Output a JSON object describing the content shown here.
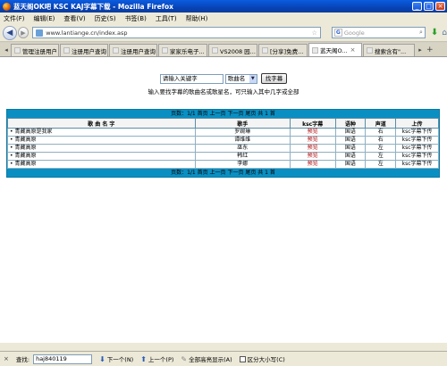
{
  "window": {
    "title": "蓝天阁OK吧 KSC KAJ字幕下载 - Mozilla Firefox"
  },
  "menu": [
    "文件(F)",
    "编辑(E)",
    "查看(V)",
    "历史(S)",
    "书签(B)",
    "工具(T)",
    "帮助(H)"
  ],
  "nav": {
    "url": "www.lantiange.cn/index.asp",
    "search_placeholder": "Google",
    "search_engine_letter": "G"
  },
  "tabs": [
    {
      "label": "管理注册用户",
      "active": false
    },
    {
      "label": "注册用户查询",
      "active": false
    },
    {
      "label": "注册用户查询",
      "active": false
    },
    {
      "label": "家家乐电子...",
      "active": false
    },
    {
      "label": "VS2008 园...",
      "active": false
    },
    {
      "label": "[分享]免费...",
      "active": false
    },
    {
      "label": "蓝天阁O...",
      "active": true
    },
    {
      "label": "搜索含有\"...",
      "active": false
    }
  ],
  "search": {
    "keyword_value": "请输入关键字",
    "select_value": "歌曲名",
    "button_label": "找字幕",
    "hint": "输入要找字幕的歌曲名或歌星名，可只输入其中几字或全部"
  },
  "pager": {
    "text": "页数：1/1  首页  上一页  下一页  尾页  共 1 首"
  },
  "table": {
    "headers": [
      "歌 曲 名 字",
      "歌手",
      "ksc字幕",
      "语种",
      "声道",
      "上传"
    ],
    "rows": [
      {
        "song": "• 青藏高原是我家",
        "singer": "罗婉琳",
        "ksc": "预览",
        "lang": "国语",
        "channel": "右",
        "upload": "ksc字幕下传"
      },
      {
        "song": "• 青藏高原",
        "singer": "谭维维",
        "ksc": "预览",
        "lang": "国语",
        "channel": "右",
        "upload": "ksc字幕下传"
      },
      {
        "song": "• 青藏高原",
        "singer": "巫东",
        "ksc": "预览",
        "lang": "国语",
        "channel": "左",
        "upload": "ksc字幕下传"
      },
      {
        "song": "• 青藏高原",
        "singer": "韩红",
        "ksc": "预览",
        "lang": "国语",
        "channel": "左",
        "upload": "ksc字幕下传"
      },
      {
        "song": "• 青藏高原",
        "singer": "李娜",
        "ksc": "预览",
        "lang": "国语",
        "channel": "左",
        "upload": "ksc字幕下传"
      }
    ]
  },
  "findbar": {
    "label": "查找:",
    "value": "haj840119",
    "next": "下一个(N)",
    "prev": "上一个(P)",
    "highlight": "全部高亮显示(A)",
    "match_case": "区分大小写(C)"
  }
}
